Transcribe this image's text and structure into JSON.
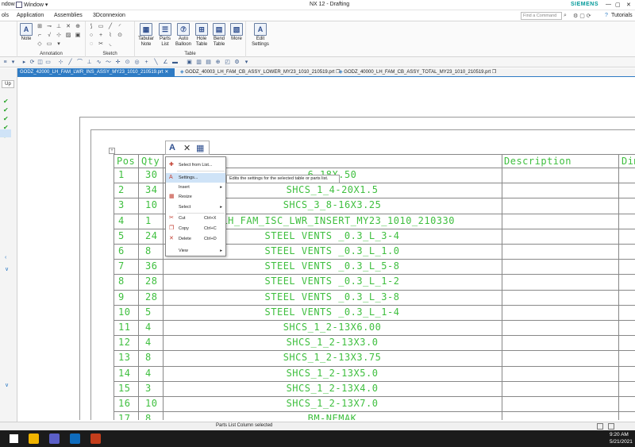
{
  "titlebar": {
    "left_frag": "ndow",
    "window_menu": "Window ▾",
    "quick_arrow": "▾",
    "title": "NX 12 - Drafting",
    "brand": "SIEMENS",
    "win_min": "—",
    "win_max": "▢",
    "win_close": "✕"
  },
  "menu": {
    "items": [
      "ols",
      "Application",
      "Assemblies",
      "3Dconnexion"
    ],
    "search_placeholder": "Find a Command",
    "tutorials": "Tutorials"
  },
  "ribbon": {
    "note": "Note",
    "annotation_group": "Annotation",
    "sketch_group": "Sketch",
    "table_group": "Table",
    "tabular_note": "Tabular Note",
    "parts_list": "Parts List",
    "auto_balloon": "Auto Balloon",
    "hole_table": "Hole Table",
    "bend_table": "Bend Table",
    "more": "More",
    "edit_settings": "Edit Settings"
  },
  "doctabs": [
    {
      "label": "GODZ_42000_LH_FAM_LWR_INS_ASSY_MY23_1010_210519.prt",
      "active": true
    },
    {
      "label": "GODZ_40003_LH_FAM_CB_ASSY_LOWER_MY23_1010_210519.prt",
      "active": false
    },
    {
      "label": "GODZ_40000_LH_FAM_CB_ASSY_TOTAL_MY23_1010_210519.prt",
      "active": false
    }
  ],
  "left_strip": {
    "up_label": "Up"
  },
  "parts_list": {
    "headers": {
      "pos": "Pos",
      "qty": "Qty",
      "description": "Description",
      "dim": "Dim"
    },
    "rows": [
      {
        "pos": "1",
        "qty": "30",
        "name": "6-18X.50"
      },
      {
        "pos": "2",
        "qty": "34",
        "name": "SHCS_1_4-20X1.5"
      },
      {
        "pos": "3",
        "qty": "10",
        "name": "SHCS_3_8-16X3.25"
      },
      {
        "pos": "4",
        "qty": "1",
        "name": "0_LH_FAM_ISC_LWR_INSERT_MY23_1010_210330"
      },
      {
        "pos": "5",
        "qty": "24",
        "name": "STEEL VENTS _0.3_L_3-4"
      },
      {
        "pos": "6",
        "qty": "8",
        "name": "STEEL VENTS _0.3_L_1.0"
      },
      {
        "pos": "7",
        "qty": "36",
        "name": "STEEL VENTS _0.3_L_5-8"
      },
      {
        "pos": "8",
        "qty": "28",
        "name": "STEEL VENTS _0.3_L_1-2"
      },
      {
        "pos": "9",
        "qty": "28",
        "name": "STEEL VENTS _0.3_L_3-8"
      },
      {
        "pos": "10",
        "qty": "5",
        "name": "STEEL VENTS _0.3_L_1-4"
      },
      {
        "pos": "11",
        "qty": "4",
        "name": "SHCS_1_2-13X6.00"
      },
      {
        "pos": "12",
        "qty": "4",
        "name": "SHCS_1_2-13X3.0"
      },
      {
        "pos": "13",
        "qty": "8",
        "name": "SHCS_1_2-13X3.75"
      },
      {
        "pos": "14",
        "qty": "4",
        "name": "SHCS_1_2-13X5.0"
      },
      {
        "pos": "15",
        "qty": "3",
        "name": "SHCS_1_2-13X4.0"
      },
      {
        "pos": "16",
        "qty": "10",
        "name": "SHCS_1_2-13X7.0"
      },
      {
        "pos": "17",
        "qty": "8",
        "name": "BM-NEMAK"
      }
    ]
  },
  "context_menu": {
    "items": [
      {
        "label": "Select from List...",
        "icon": "✚",
        "shortcut": "",
        "arrow": ""
      },
      {
        "label": "Settings...",
        "icon": "A",
        "shortcut": "",
        "arrow": "",
        "highlight": true
      },
      {
        "label": "Insert",
        "icon": "",
        "shortcut": "",
        "arrow": "▸"
      },
      {
        "label": "Resize",
        "icon": "▦",
        "shortcut": "",
        "arrow": ""
      },
      {
        "label": "Select",
        "icon": "",
        "shortcut": "",
        "arrow": "▸"
      },
      {
        "label": "Cut",
        "icon": "✂",
        "shortcut": "Ctrl+X",
        "arrow": ""
      },
      {
        "label": "Copy",
        "icon": "❐",
        "shortcut": "Ctrl+C",
        "arrow": ""
      },
      {
        "label": "Delete",
        "icon": "✕",
        "shortcut": "Ctrl+D",
        "arrow": ""
      },
      {
        "label": "View",
        "icon": "",
        "shortcut": "",
        "arrow": "▸"
      }
    ],
    "tooltip": "Edits the settings for the selected table or parts list."
  },
  "status": {
    "message": "Parts List Column selected"
  },
  "taskbar": {
    "time": "9:20 AM",
    "date": "5/21/2021"
  },
  "colors": {
    "accent": "#2e7bc4",
    "table_green": "#3fbf3f",
    "brand": "#009999"
  }
}
